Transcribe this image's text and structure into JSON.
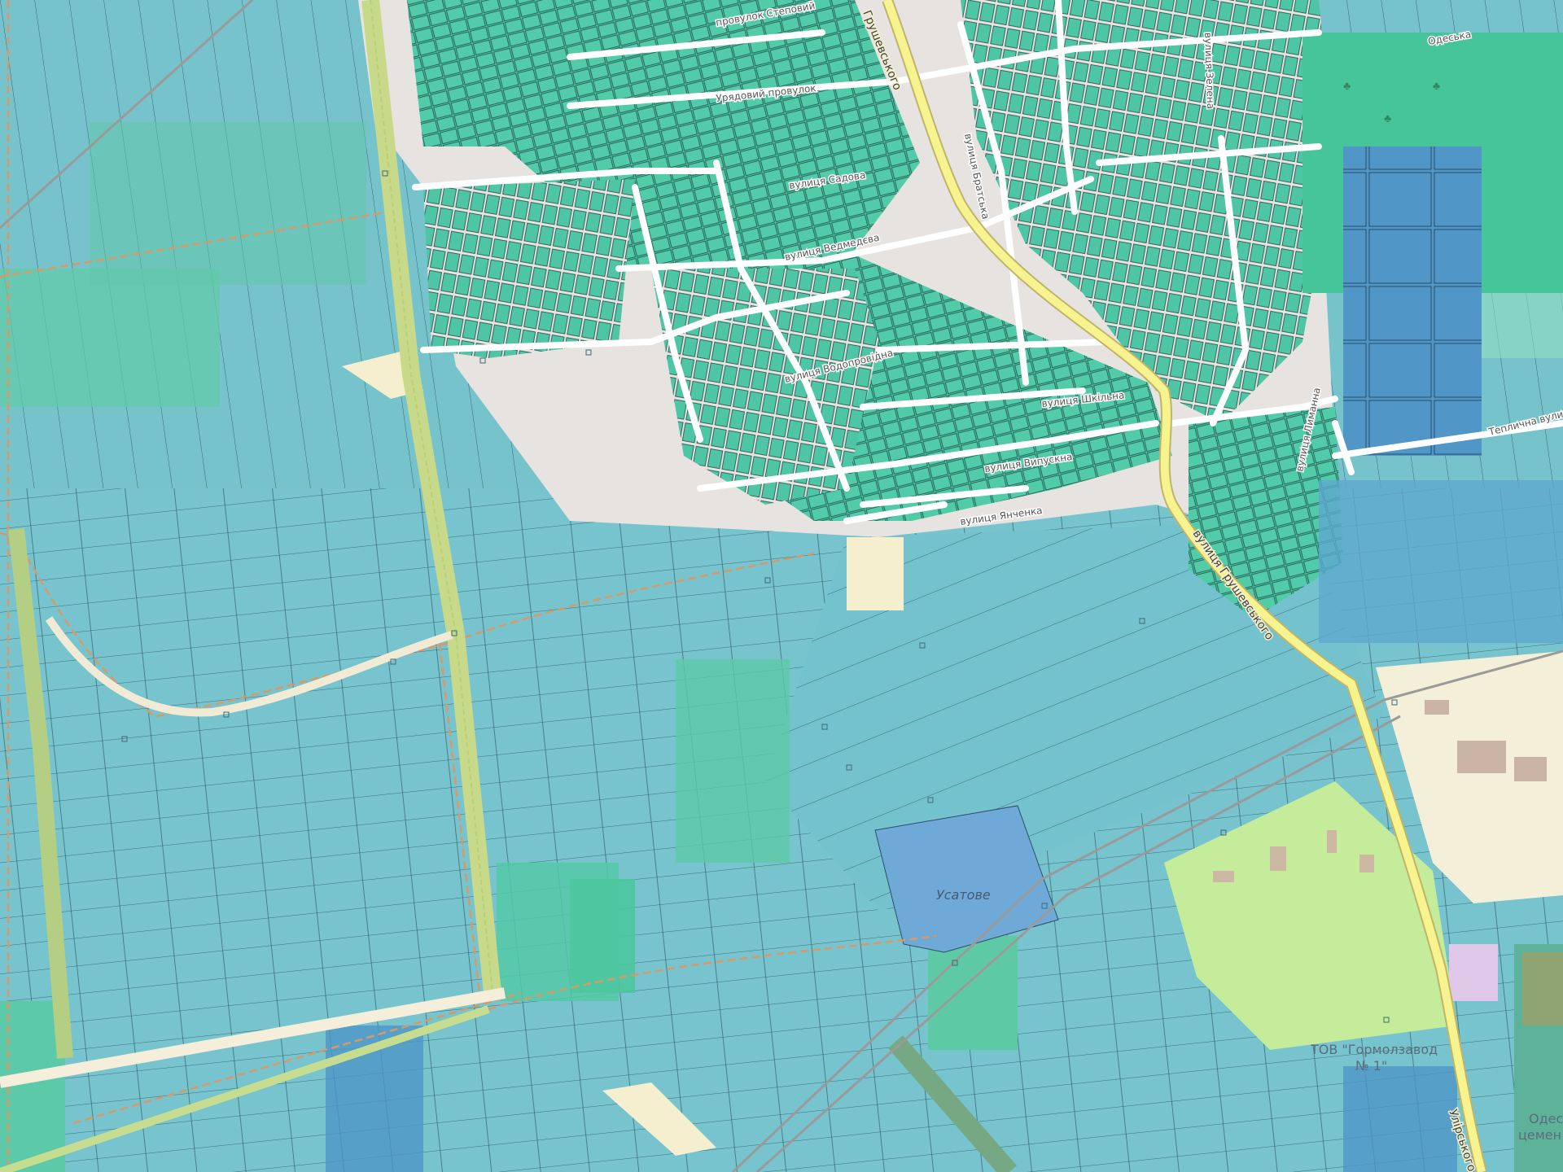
{
  "map": {
    "colors": {
      "field": "#76c3cc",
      "field_dark": "#6bb9cf",
      "garden": "#5cc9a8",
      "residential_plot": "#4cc7a3",
      "industrial": "#6fa9d8",
      "greenhouse": "#4d96c7",
      "forest": "#46c59a",
      "grass": "#c4ec9a",
      "sand": "#f5efcf",
      "urban": "#e6e3e0",
      "primary_road": "#f7f38e",
      "road": "#ffffff",
      "parcel_line": "#2b4f57",
      "boundary": "#d59a6a",
      "rail": "#9a9a9a"
    },
    "labels": {
      "hrushevskoho_main": "вулиця Грушевського",
      "hrushevskoho_top": "Грушевського",
      "odeska": "Одеська",
      "uriadovyi_lane": "Урядовий провулок",
      "stepova_lane": "провулок Степовий",
      "sadova": "вулиця Садова",
      "vedmedieva": "вулиця Ведмедєва",
      "vodoprovidna": "вулиця Водопровідна",
      "shkilna": "вулиця Шкільна",
      "vypustna": "вулиця Випускна",
      "yanchenka": "вулиця Янченка",
      "bratska": "вулиця Братська",
      "zelena": "вулиця Зелена",
      "lymanna": "вулиця Лиманна",
      "teplychna": "Теплична вулиця",
      "usatove": "Усатове",
      "uliurskoho": "Улірського",
      "tov_line1": "ТОВ \"Гормолзавод",
      "tov_line2": "№ 1\"",
      "cement_line1": "Одес",
      "cement_line2": "цемен"
    },
    "icons": [
      "forest-tree-icon",
      "survey-point-icon"
    ]
  }
}
